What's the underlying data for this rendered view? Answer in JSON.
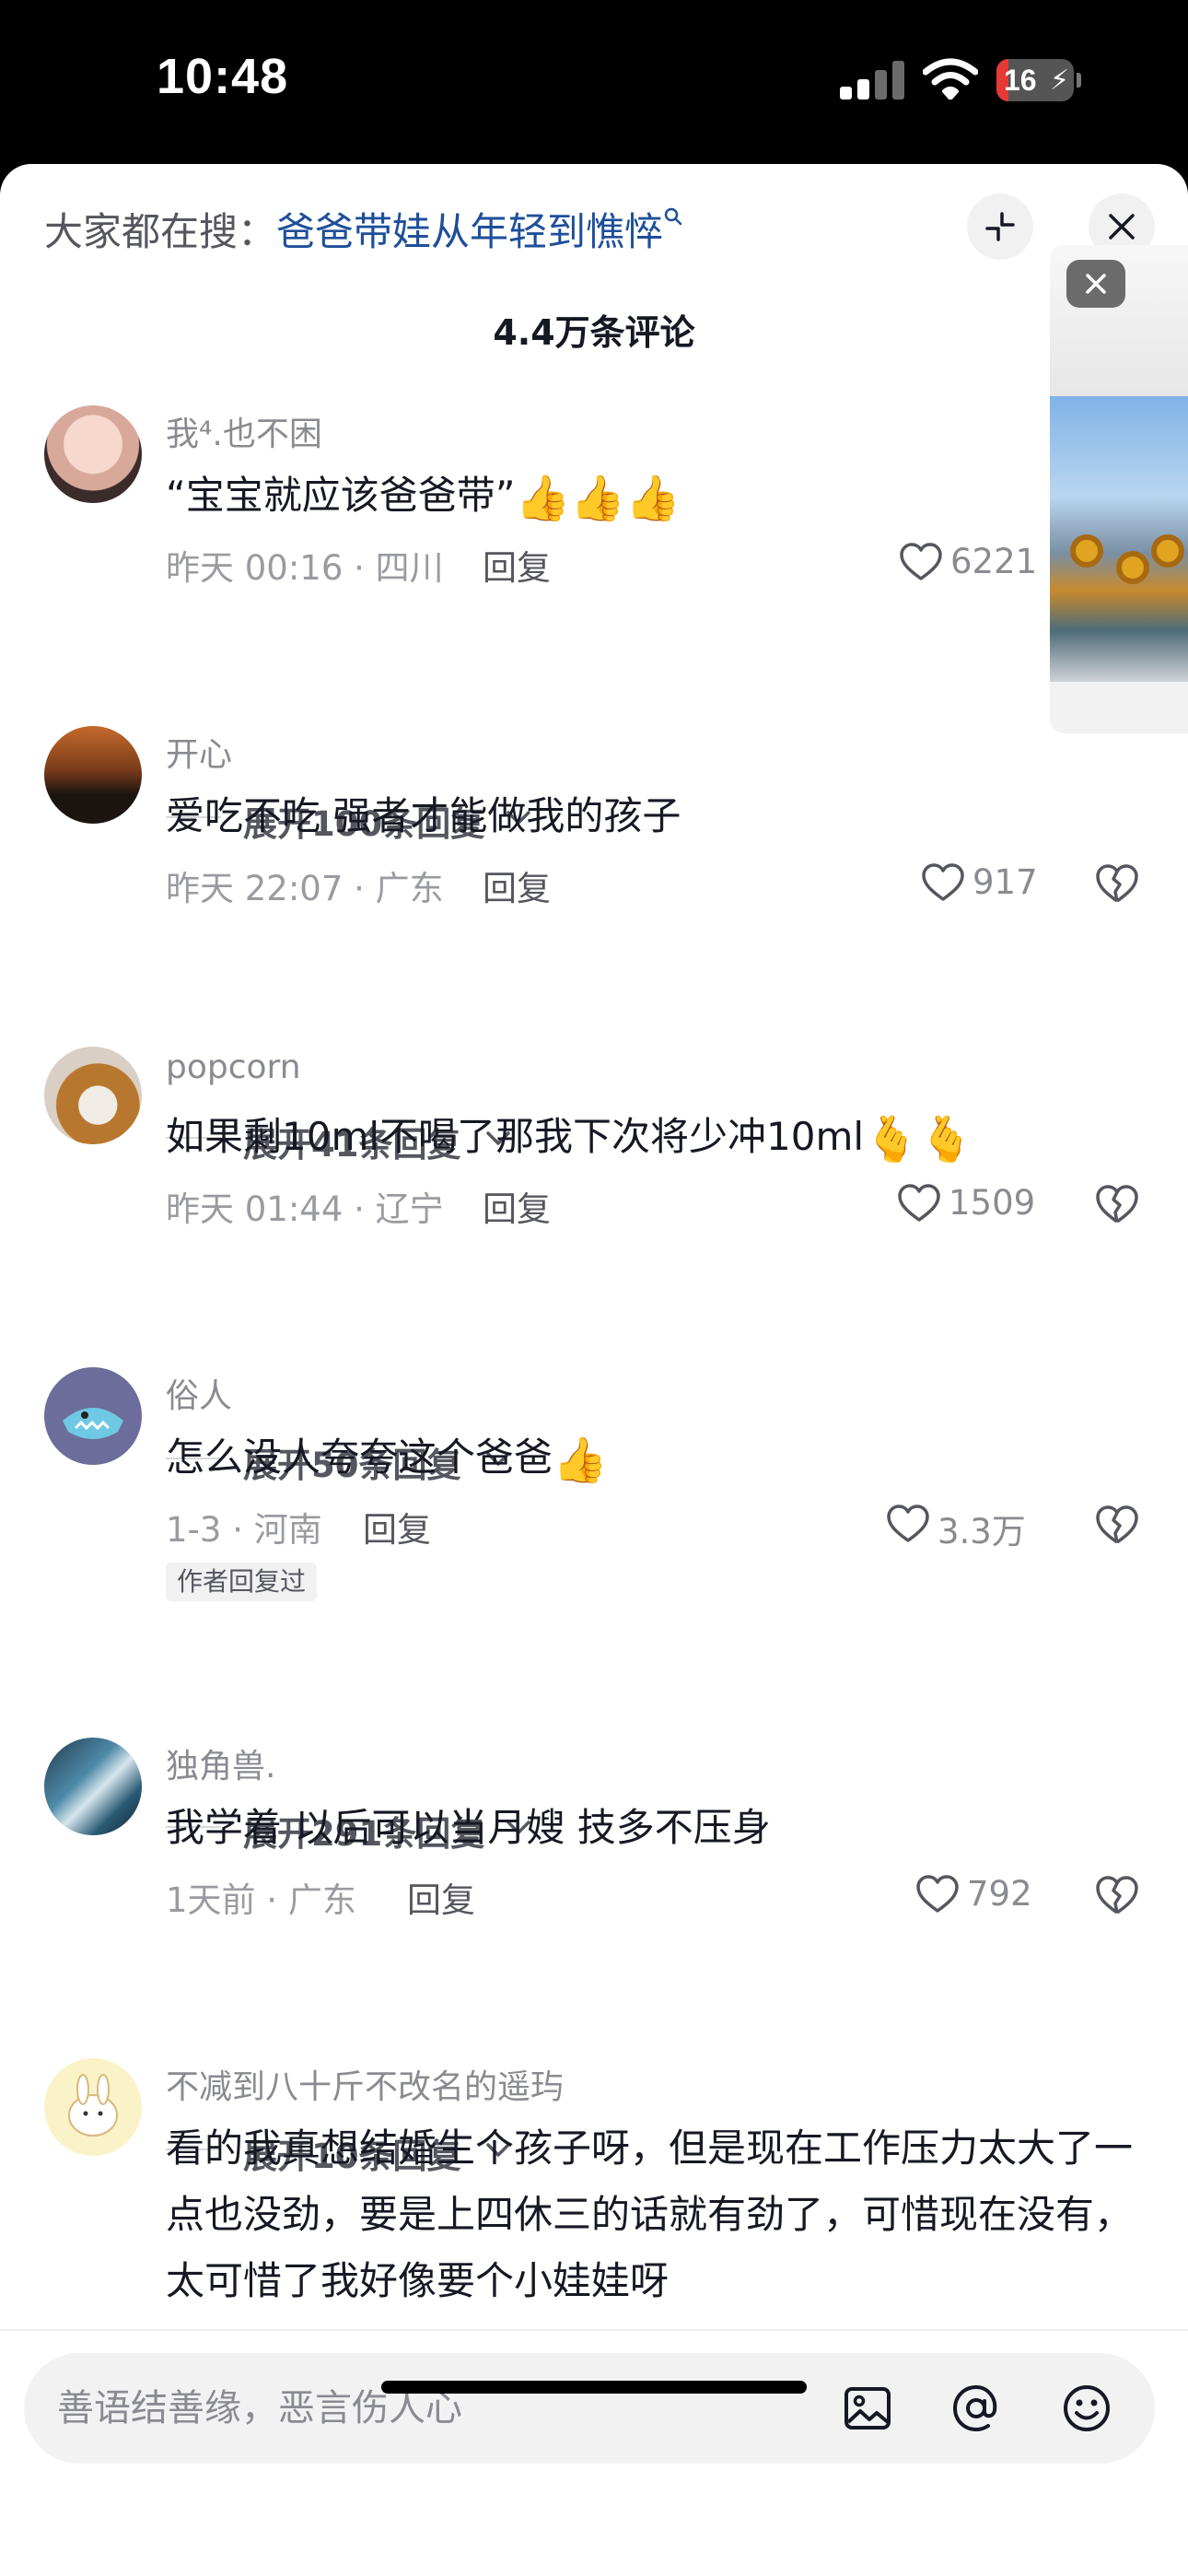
{
  "status_bar": {
    "time": "10:48",
    "battery": "16",
    "battery_level": 0.16
  },
  "hot_search": {
    "prefix": "大家都在搜：",
    "query": "爸爸带娃从年轻到憔悴"
  },
  "comment_count": "4.4万条评论",
  "comments": [
    {
      "username": "我⁴.也不困",
      "text": "“宝宝就应该爸爸带”",
      "emoji": "👍👍👍",
      "meta": "昨天 00:16 · 四川",
      "reply": "回复",
      "likes": "6221",
      "expand": "展开100条回复"
    },
    {
      "username": "开心",
      "text": "爱吃不吃 强者才能做我的孩子",
      "emoji": "",
      "meta": "昨天 22:07 · 广东",
      "reply": "回复",
      "likes": "917",
      "expand": "展开41条回复"
    },
    {
      "username": "popcorn",
      "text": "如果剩10ml不喝了那我下次将少冲10ml",
      "emoji": "🫰🫰",
      "meta": "昨天 01:44 · 辽宁",
      "reply": "回复",
      "likes": "1509",
      "expand": "展开50条回复"
    },
    {
      "username": "俗人",
      "text": "怎么没人夸夸这个爸爸",
      "emoji": "👍",
      "meta": "1-3 · 河南",
      "reply": "回复",
      "likes": "3.3万",
      "author_tag": "作者回复过",
      "expand": "展开291条回复"
    },
    {
      "username": "独角兽.",
      "text": "我学着 以后可以当月嫂 技多不压身",
      "emoji": "",
      "meta": "1天前 · 广东",
      "reply": "回复",
      "likes": "792",
      "expand": "展开10条回复"
    },
    {
      "username": "不减到八十斤不改名的遥玙",
      "text": "看的我真想结婚生个孩子呀，但是现在工作压力太大了一点也没劲，要是上四休三的话就有劲了，可惜现在没有，太可惜了我好像要个小娃娃呀",
      "emoji": ""
    }
  ],
  "input": {
    "placeholder": "善语结善缘，恶言伤人心"
  },
  "icons": {
    "minimize": "minimize-icon",
    "close": "close-icon",
    "search": "search-icon",
    "like": "heart-icon",
    "dislike": "broken-heart-icon",
    "expand": "chevron-down-icon",
    "image": "image-icon",
    "mention": "at-icon",
    "emoji": "smiley-icon"
  },
  "colors": {
    "link": "#1e4f9a",
    "text": "#161823",
    "muted": "#8a8b91",
    "battery_low": "#e53935"
  }
}
